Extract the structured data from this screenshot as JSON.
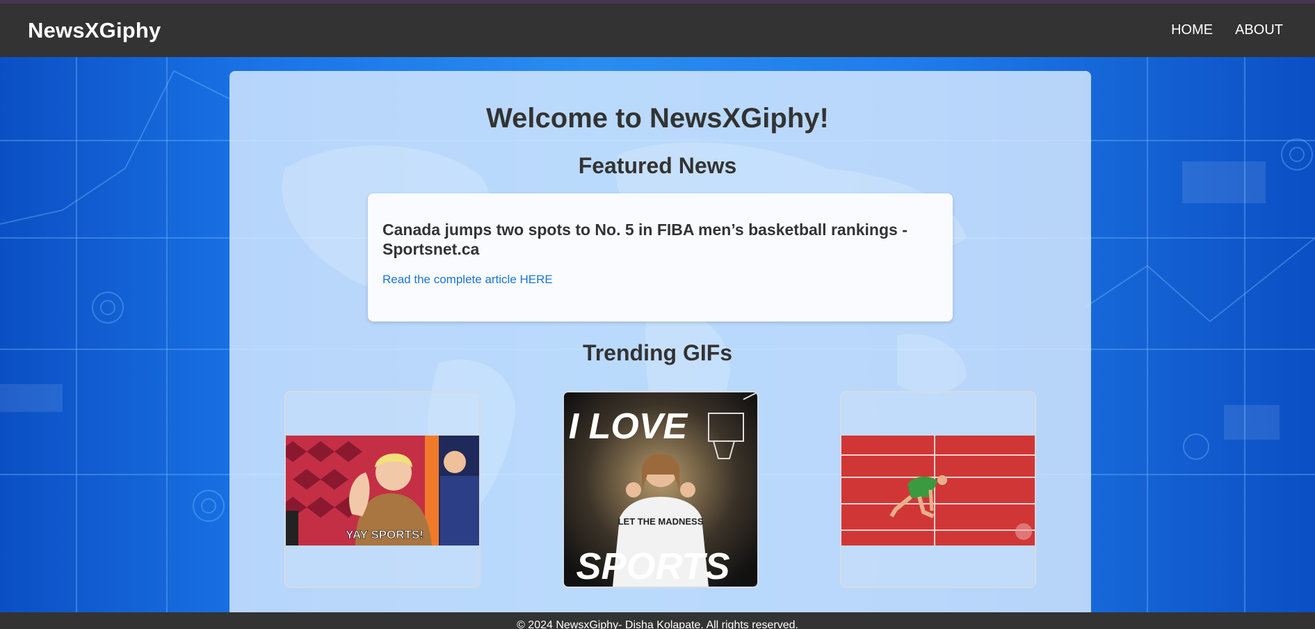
{
  "brand": "NewsXGiphy",
  "nav": {
    "home": "HOME",
    "about": "ABOUT"
  },
  "welcome": "Welcome to NewsXGiphy!",
  "featured_heading": "Featured News",
  "news": {
    "title": "Canada jumps two spots to No. 5 in FIBA men’s basketball rankings - Sportsnet.ca",
    "link_text": "Read the complete article HERE"
  },
  "trending_heading": "Trending GIFs",
  "gifs": [
    {
      "caption": "YAY SPORTS!"
    },
    {
      "top_text": "I LOVE",
      "shirt_text": "LET THE MADNESS",
      "bottom_text": "SPORTS"
    },
    {
      "caption": ""
    }
  ],
  "footer": "© 2024 NewsxGiphy- Disha Kolapate. All rights reserved.",
  "colors": {
    "navbar": "#333333",
    "link": "#1a73d9",
    "panel": "#daecff",
    "background": "#1565d8"
  }
}
